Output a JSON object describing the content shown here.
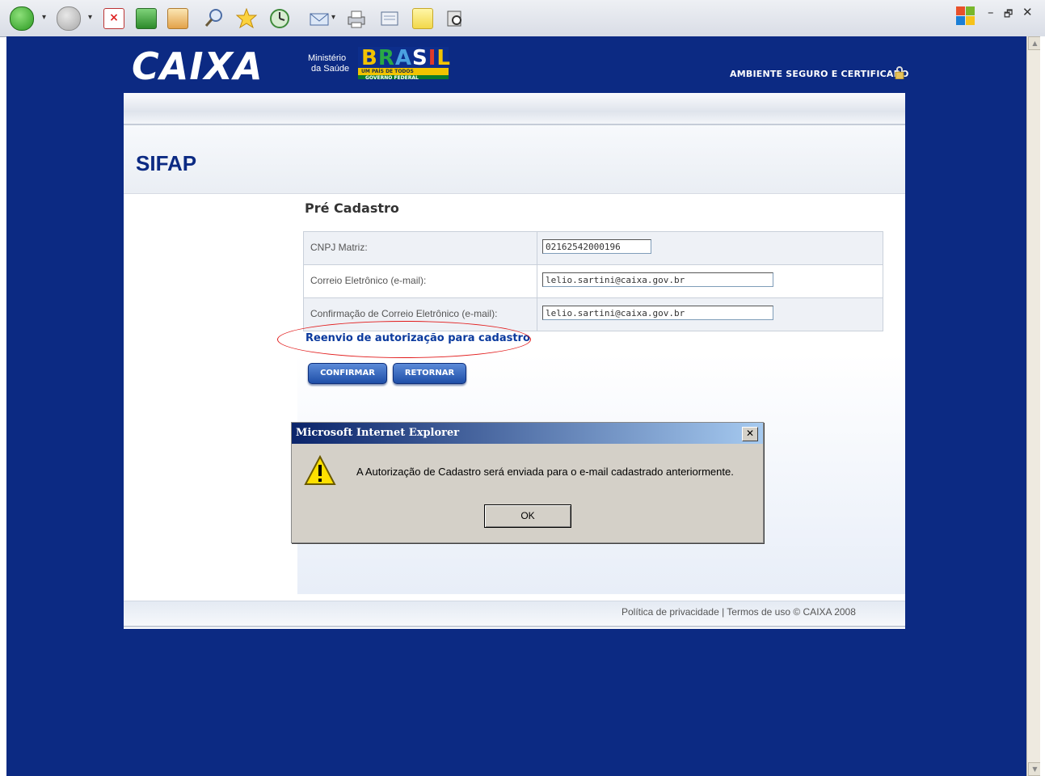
{
  "browser": {
    "dialog_title": "Microsoft Internet Explorer",
    "dialog_message": "A Autorização de Cadastro será enviada para o e-mail cadastrado anteriormente.",
    "dialog_ok": "OK",
    "dialog_close": "✕",
    "window_minimize": "–",
    "window_restore": "🗗",
    "window_close": "✕"
  },
  "header": {
    "logo": "CAIXA",
    "ministerio_line1": "Ministério",
    "ministerio_line2": "da Saúde",
    "brasil_logo": "BRASIL",
    "brasil_tagline": "UM PAÍS DE TODOS",
    "brasil_sub": "GOVERNO FEDERAL",
    "secure_text": "AMBIENTE SEGURO E CERTIFICADO"
  },
  "page": {
    "app_title": "SIFAP",
    "form_title": "Pré Cadastro",
    "fields": [
      {
        "label": "CNPJ Matriz:",
        "value": "02162542000196"
      },
      {
        "label": "Correio Eletrônico (e-mail):",
        "value": "lelio.sartini@caixa.gov.br"
      },
      {
        "label": "Confirmação de Correio Eletrônico (e-mail):",
        "value": "lelio.sartini@caixa.gov.br"
      }
    ],
    "resend_link": "Reenvio de autorização para cadastro",
    "confirm_button": "CONFIRMAR",
    "return_button": "RETORNAR",
    "footer": "Política de privacidade | Termos de uso © CAIXA 2008"
  },
  "colors": {
    "page_background": "#0c2a83",
    "annotation_circle": "#e21b1b"
  }
}
